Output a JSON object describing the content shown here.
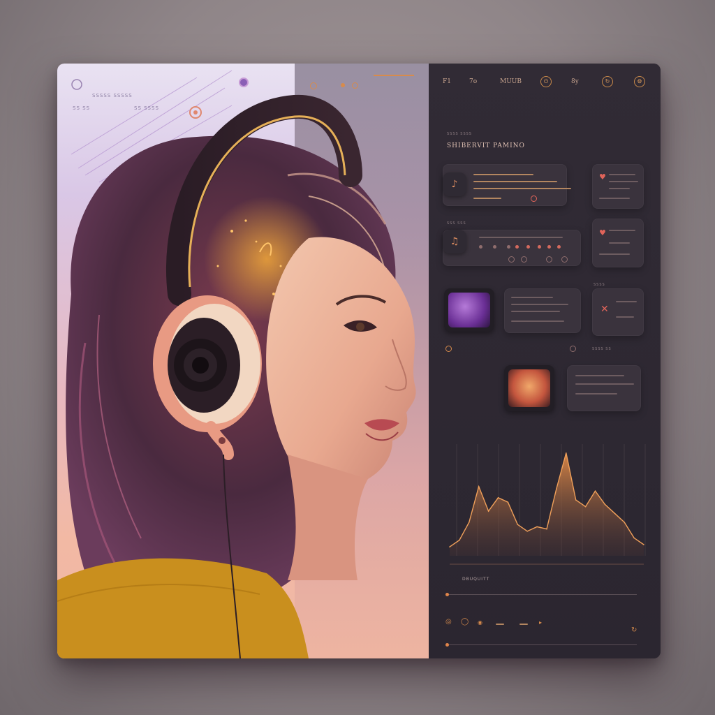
{
  "topbar": {
    "items": [
      "F1",
      "7o",
      "MUUB",
      "8y"
    ]
  },
  "art": {
    "labels": [
      "SSSSS SSSSS",
      "SS SSSS",
      "SS SS"
    ]
  },
  "dashboard": {
    "section_title": "SHIBERVIT PAMINO",
    "chart_label": "DBUQUITT",
    "tiny_labels": [
      "SSSS SSSS",
      "SSS SSS",
      "SSSS",
      "SSSS SS"
    ]
  },
  "colors": {
    "accent": "#e0854a",
    "accent_pink": "#e0645a",
    "panel": "#3a333d",
    "background": "#2b2630"
  },
  "icons": [
    "settings-icon",
    "power-icon",
    "refresh-icon",
    "note-icon",
    "tag-icon",
    "play-icon"
  ],
  "chart_data": {
    "type": "area",
    "x": [
      0,
      1,
      2,
      3,
      4,
      5,
      6,
      7,
      8,
      9,
      10,
      11,
      12,
      13,
      14,
      15,
      16,
      17,
      18,
      19,
      20
    ],
    "values": [
      8,
      14,
      30,
      62,
      40,
      52,
      48,
      28,
      22,
      26,
      24,
      60,
      92,
      50,
      44,
      58,
      46,
      38,
      30,
      16,
      10
    ],
    "ylim": [
      0,
      100
    ],
    "grid": false,
    "xlabel": "",
    "ylabel": "",
    "title": ""
  }
}
